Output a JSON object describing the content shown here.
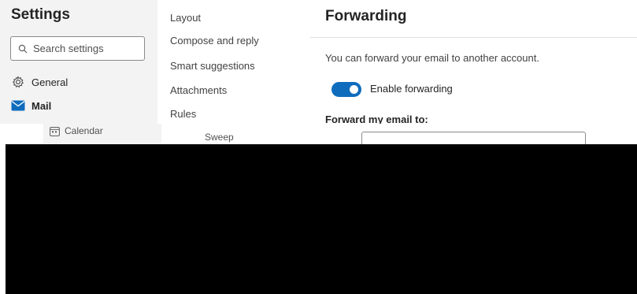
{
  "settings": {
    "title": "Settings",
    "search_placeholder": "Search settings"
  },
  "nav": {
    "general": "General",
    "mail": "Mail",
    "calendar": "Calendar"
  },
  "submenu": {
    "items": [
      "Layout",
      "Compose and reply",
      "Smart suggestions",
      "Attachments",
      "Rules",
      "Sweep"
    ]
  },
  "forwarding": {
    "title": "Forwarding",
    "description": "You can forward your email to another account.",
    "toggle_label": "Enable forwarding",
    "toggle_on": true,
    "forward_label": "Forward my email to:"
  },
  "colors": {
    "accent": "#0f6cbd",
    "sidebar_bg": "#f3f3f3"
  }
}
